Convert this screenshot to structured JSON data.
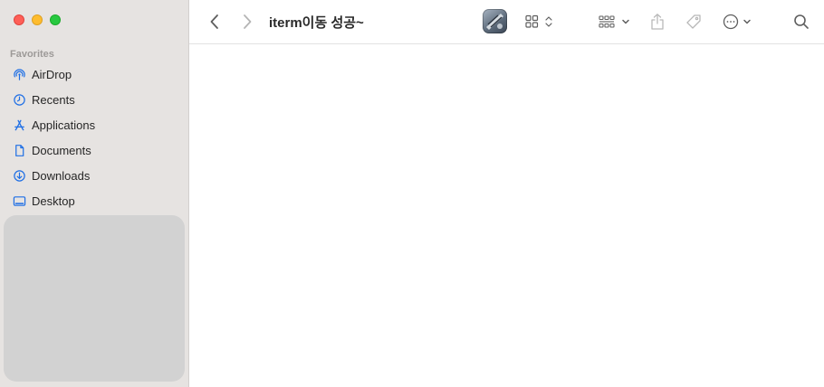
{
  "window": {
    "title": "iterm이동 성공~"
  },
  "sidebar": {
    "section_title": "Favorites",
    "items": [
      {
        "label": "AirDrop",
        "icon": "airdrop-icon"
      },
      {
        "label": "Recents",
        "icon": "clock-icon"
      },
      {
        "label": "Applications",
        "icon": "applications-icon"
      },
      {
        "label": "Documents",
        "icon": "document-icon"
      },
      {
        "label": "Downloads",
        "icon": "download-icon"
      },
      {
        "label": "Desktop",
        "icon": "desktop-icon"
      }
    ]
  },
  "toolbar": {
    "icons": [
      "back-icon",
      "forward-icon",
      "app-icon",
      "grid-view-icon",
      "group-icon",
      "share-icon",
      "tag-icon",
      "more-icon",
      "search-icon"
    ]
  },
  "colors": {
    "accent": "#1f6fe5",
    "sidebar_bg": "#e6e3e1",
    "close": "#fe5f57",
    "minimize": "#febc2e",
    "zoom": "#28c840"
  }
}
